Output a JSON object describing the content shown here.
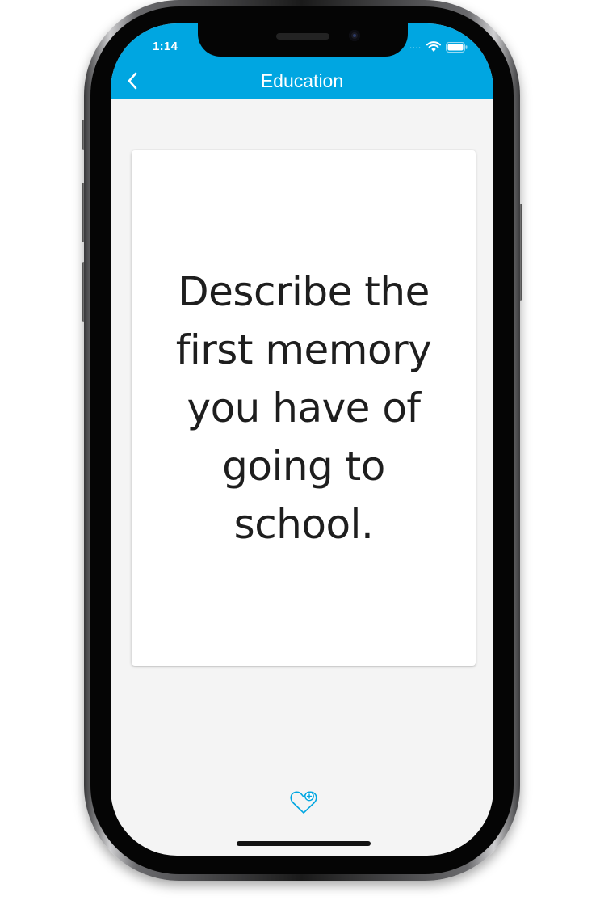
{
  "status_bar": {
    "time": "1:14",
    "signal_indicator": "····",
    "wifi_icon": "wifi-icon",
    "battery_icon": "battery-icon"
  },
  "navigation": {
    "title": "Education",
    "back_icon": "chevron-left-icon"
  },
  "card": {
    "prompt": "Describe the first memory you have of going to school."
  },
  "actions": {
    "favorite_icon": "heart-plus-icon"
  },
  "colors": {
    "accent": "#00a6e1",
    "background": "#f4f4f4",
    "card": "#ffffff",
    "text": "#1e1e1e"
  }
}
